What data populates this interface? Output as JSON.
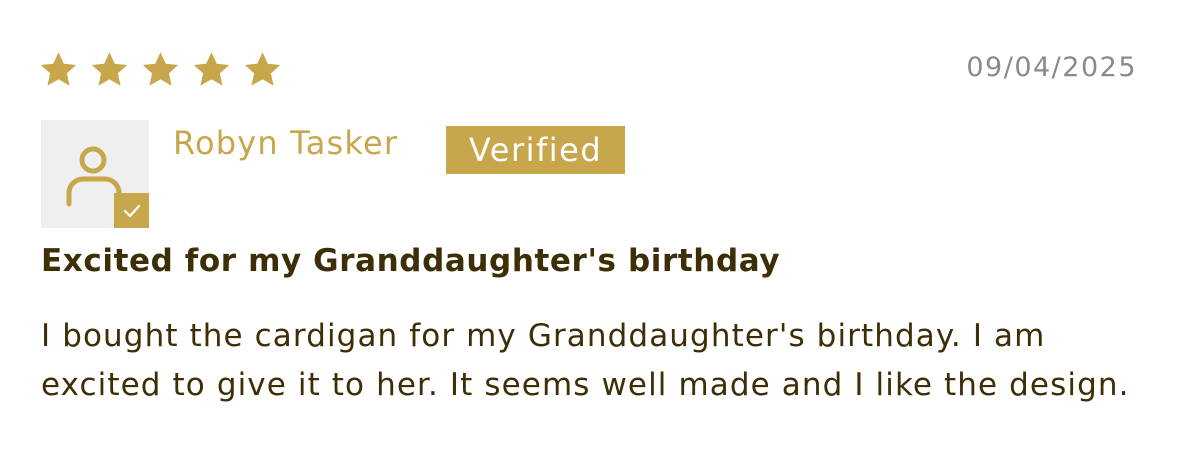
{
  "review": {
    "rating": 5,
    "rating_max": 5,
    "date": "09/04/2025",
    "reviewer": {
      "name": "Robyn Tasker",
      "avatar_icon": "user-icon",
      "avatar_badge_icon": "check-icon",
      "verified_label": "Verified"
    },
    "title": "Excited for my Granddaughter's birthday",
    "body": "I bought the cardigan for my Granddaughter's birthday. I am excited to give it to her. It seems well made and I like the design."
  },
  "colors": {
    "accent": "#c8a64b",
    "text": "#3d2e06",
    "muted": "#8a8a8a",
    "avatar_bg": "#efefef"
  }
}
